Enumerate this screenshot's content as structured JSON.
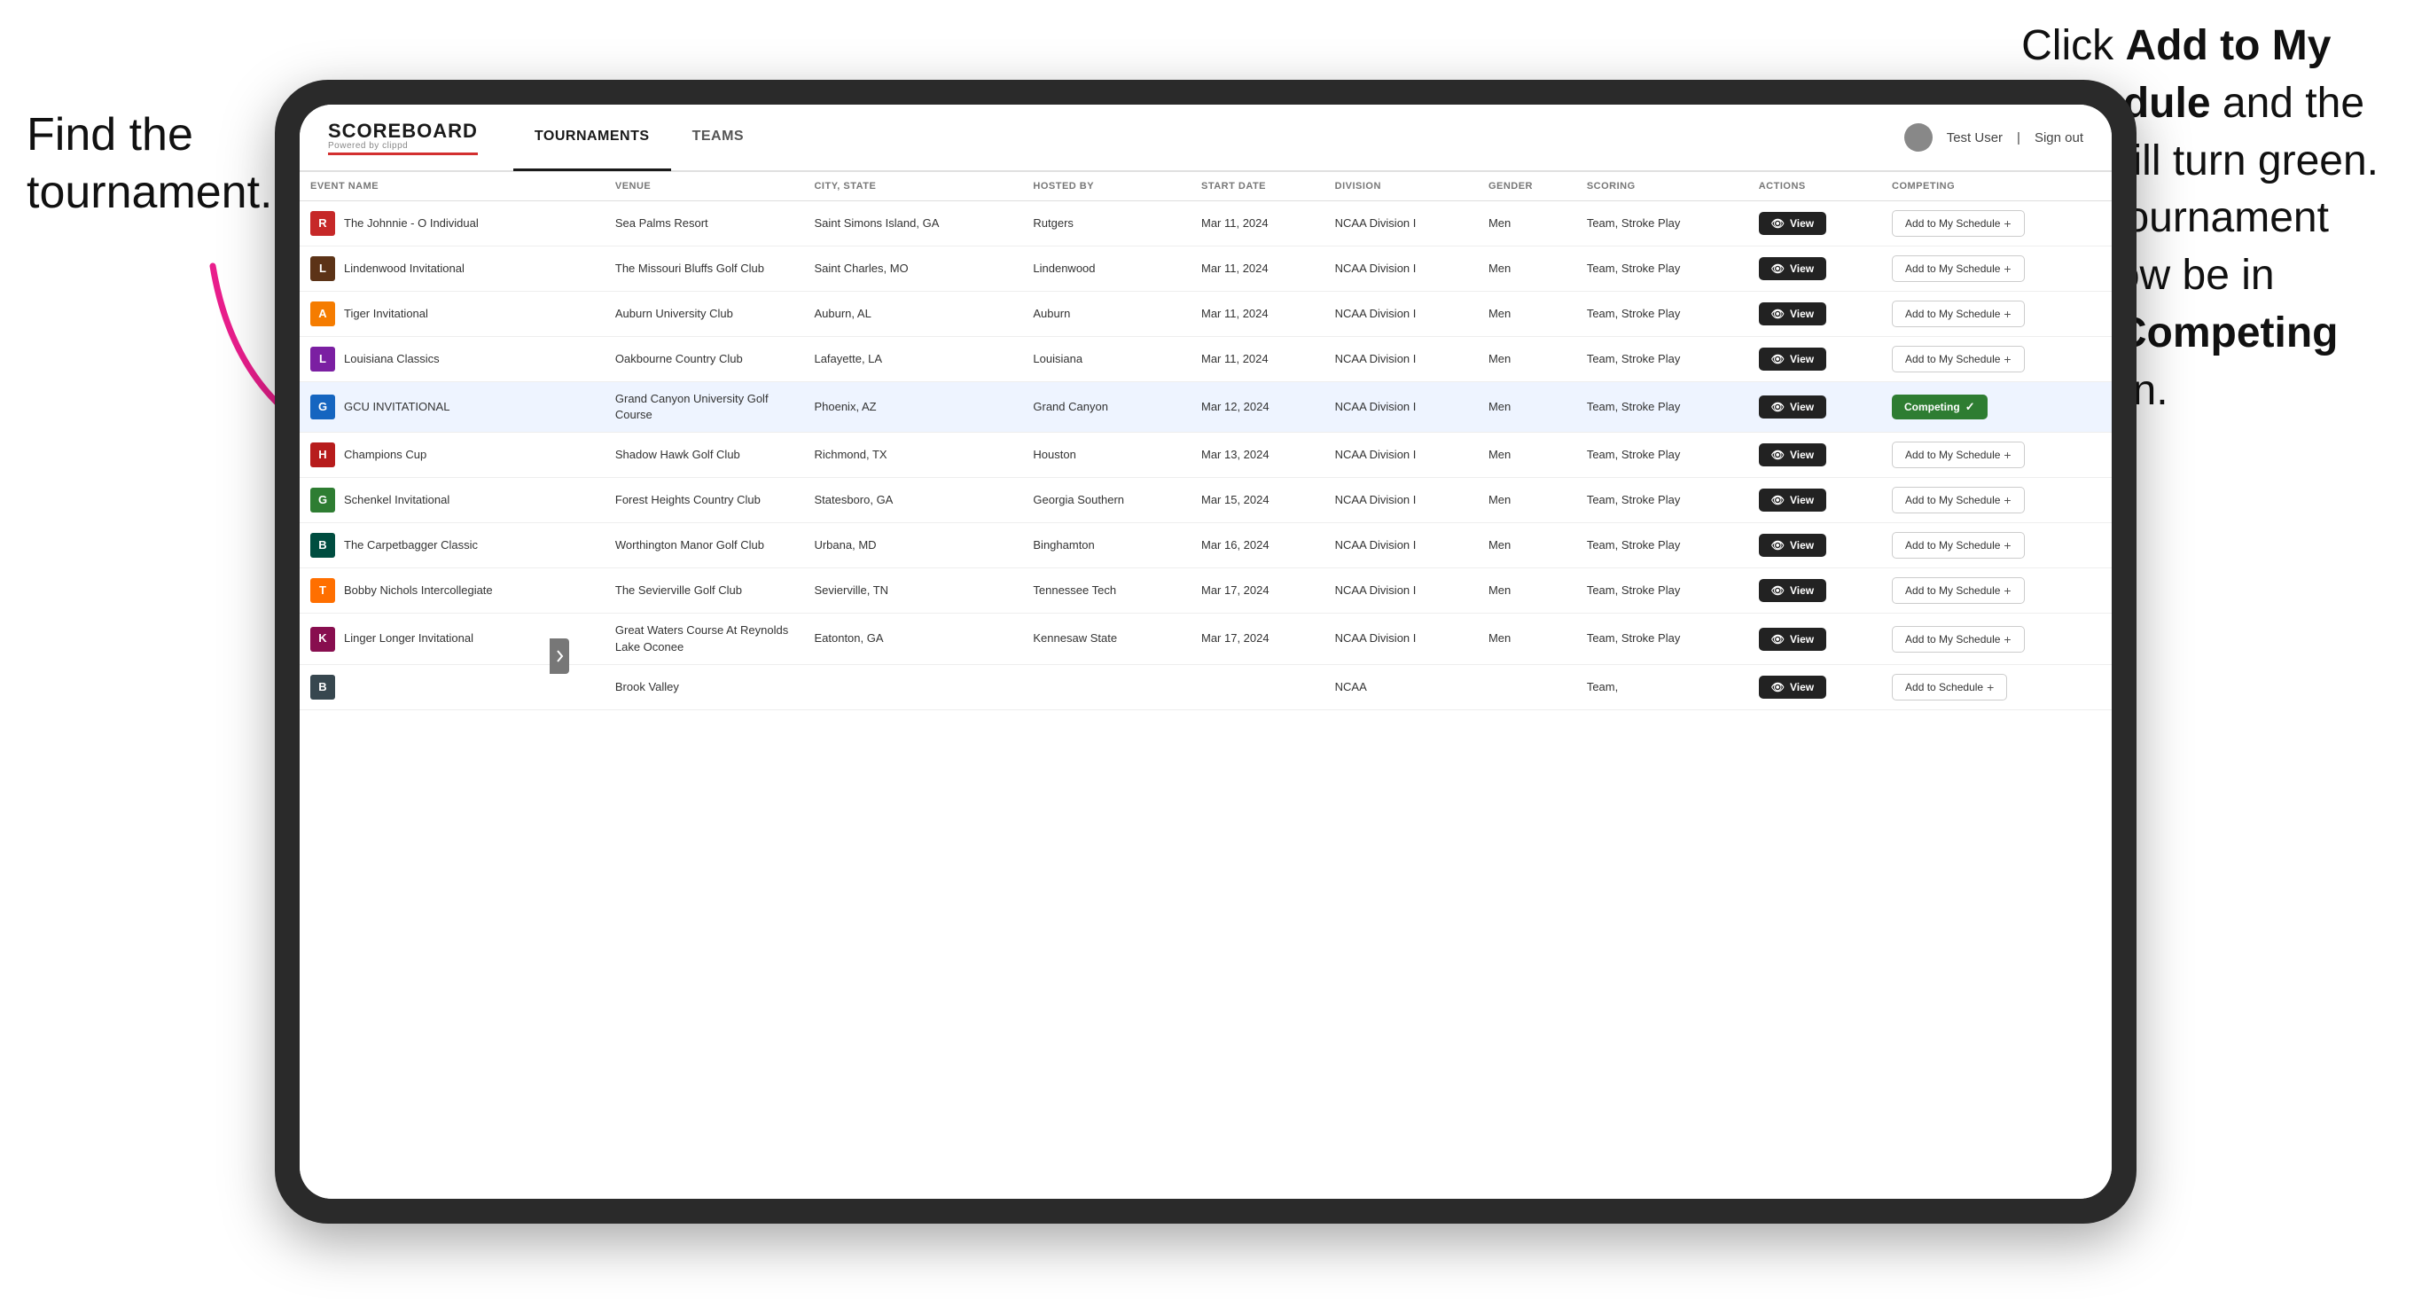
{
  "annotations": {
    "left": "Find the\ntournament.",
    "right_line1": "Click ",
    "right_bold1": "Add to My\nSchedule",
    "right_line2": " and the\nbox will turn green.\nThis tournament\nwill now be in\nyour ",
    "right_bold2": "Competing",
    "right_line3": "\nsection."
  },
  "header": {
    "logo": "SCOREBOARD",
    "logo_sub": "Powered by clippd",
    "nav_tabs": [
      "TOURNAMENTS",
      "TEAMS"
    ],
    "active_tab": "TOURNAMENTS",
    "user": "Test User",
    "sign_out": "Sign out"
  },
  "table": {
    "columns": [
      "EVENT NAME",
      "VENUE",
      "CITY, STATE",
      "HOSTED BY",
      "START DATE",
      "DIVISION",
      "GENDER",
      "SCORING",
      "ACTIONS",
      "COMPETING"
    ],
    "rows": [
      {
        "logo_color": "#c62828",
        "logo_letter": "R",
        "event": "The Johnnie - O Individual",
        "venue": "Sea Palms Resort",
        "city_state": "Saint Simons Island, GA",
        "hosted_by": "Rutgers",
        "start_date": "Mar 11, 2024",
        "division": "NCAA Division I",
        "gender": "Men",
        "scoring": "Team, Stroke Play",
        "action": "View",
        "competing": "Add to My Schedule",
        "is_competing": false,
        "highlighted": false
      },
      {
        "logo_color": "#5c3317",
        "logo_letter": "L",
        "event": "Lindenwood Invitational",
        "venue": "The Missouri Bluffs Golf Club",
        "city_state": "Saint Charles, MO",
        "hosted_by": "Lindenwood",
        "start_date": "Mar 11, 2024",
        "division": "NCAA Division I",
        "gender": "Men",
        "scoring": "Team, Stroke Play",
        "action": "View",
        "competing": "Add to My Schedule",
        "is_competing": false,
        "highlighted": false
      },
      {
        "logo_color": "#f57c00",
        "logo_letter": "A",
        "event": "Tiger Invitational",
        "venue": "Auburn University Club",
        "city_state": "Auburn, AL",
        "hosted_by": "Auburn",
        "start_date": "Mar 11, 2024",
        "division": "NCAA Division I",
        "gender": "Men",
        "scoring": "Team, Stroke Play",
        "action": "View",
        "competing": "Add to My Schedule",
        "is_competing": false,
        "highlighted": false
      },
      {
        "logo_color": "#7b1fa2",
        "logo_letter": "L",
        "event": "Louisiana Classics",
        "venue": "Oakbourne Country Club",
        "city_state": "Lafayette, LA",
        "hosted_by": "Louisiana",
        "start_date": "Mar 11, 2024",
        "division": "NCAA Division I",
        "gender": "Men",
        "scoring": "Team, Stroke Play",
        "action": "View",
        "competing": "Add to My Schedule",
        "is_competing": false,
        "highlighted": false
      },
      {
        "logo_color": "#1565c0",
        "logo_letter": "G",
        "event": "GCU INVITATIONAL",
        "venue": "Grand Canyon University Golf Course",
        "city_state": "Phoenix, AZ",
        "hosted_by": "Grand Canyon",
        "start_date": "Mar 12, 2024",
        "division": "NCAA Division I",
        "gender": "Men",
        "scoring": "Team, Stroke Play",
        "action": "View",
        "competing": "Competing",
        "is_competing": true,
        "highlighted": true
      },
      {
        "logo_color": "#b71c1c",
        "logo_letter": "H",
        "event": "Champions Cup",
        "venue": "Shadow Hawk Golf Club",
        "city_state": "Richmond, TX",
        "hosted_by": "Houston",
        "start_date": "Mar 13, 2024",
        "division": "NCAA Division I",
        "gender": "Men",
        "scoring": "Team, Stroke Play",
        "action": "View",
        "competing": "Add to My Schedule",
        "is_competing": false,
        "highlighted": false
      },
      {
        "logo_color": "#2e7d32",
        "logo_letter": "G",
        "event": "Schenkel Invitational",
        "venue": "Forest Heights Country Club",
        "city_state": "Statesboro, GA",
        "hosted_by": "Georgia Southern",
        "start_date": "Mar 15, 2024",
        "division": "NCAA Division I",
        "gender": "Men",
        "scoring": "Team, Stroke Play",
        "action": "View",
        "competing": "Add to My Schedule",
        "is_competing": false,
        "highlighted": false
      },
      {
        "logo_color": "#004d40",
        "logo_letter": "B",
        "event": "The Carpetbagger Classic",
        "venue": "Worthington Manor Golf Club",
        "city_state": "Urbana, MD",
        "hosted_by": "Binghamton",
        "start_date": "Mar 16, 2024",
        "division": "NCAA Division I",
        "gender": "Men",
        "scoring": "Team, Stroke Play",
        "action": "View",
        "competing": "Add to My Schedule",
        "is_competing": false,
        "highlighted": false
      },
      {
        "logo_color": "#ff6f00",
        "logo_letter": "T",
        "event": "Bobby Nichols Intercollegiate",
        "venue": "The Sevierville Golf Club",
        "city_state": "Sevierville, TN",
        "hosted_by": "Tennessee Tech",
        "start_date": "Mar 17, 2024",
        "division": "NCAA Division I",
        "gender": "Men",
        "scoring": "Team, Stroke Play",
        "action": "View",
        "competing": "Add to My Schedule",
        "is_competing": false,
        "highlighted": false
      },
      {
        "logo_color": "#880e4f",
        "logo_letter": "K",
        "event": "Linger Longer Invitational",
        "venue": "Great Waters Course At Reynolds Lake Oconee",
        "city_state": "Eatonton, GA",
        "hosted_by": "Kennesaw State",
        "start_date": "Mar 17, 2024",
        "division": "NCAA Division I",
        "gender": "Men",
        "scoring": "Team, Stroke Play",
        "action": "View",
        "competing": "Add to My Schedule",
        "is_competing": false,
        "highlighted": false
      },
      {
        "logo_color": "#37474f",
        "logo_letter": "B",
        "event": "",
        "venue": "Brook Valley",
        "city_state": "",
        "hosted_by": "",
        "start_date": "",
        "division": "NCAA",
        "gender": "",
        "scoring": "Team,",
        "action": "View",
        "competing": "Add to Schedule",
        "is_competing": false,
        "highlighted": false,
        "partial": true
      }
    ]
  }
}
